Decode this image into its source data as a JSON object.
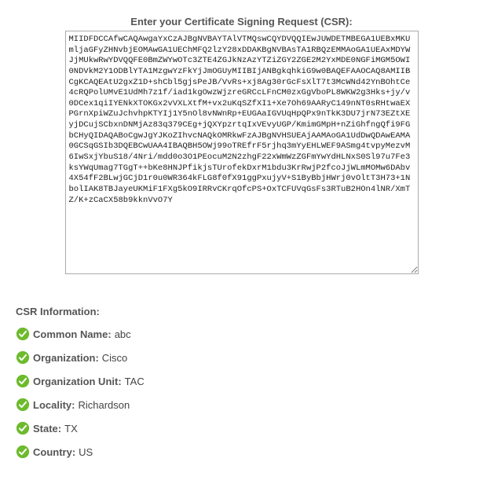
{
  "title": "Enter your Certificate Signing Request (CSR):",
  "csr_text": "MIIDFDCCAfwCAQAwgaYxCzAJBgNVBAYTAlVTMQswCQYDVQQIEwJUWDETMBEGA1UEBxMKUmljaGFyZHNvbjEOMAwGA1UEChMFQ2lzY28xDDAKBgNVBAsTA1RBQzEMMAoGA1UEAxMDYWJjMUkwRwYDVQQFE0BmZWYwOTc3ZTE4ZGJkNzAzYTZiZGY2ZGE2M2YxMDE0NGFiMGM5OWI0NDVkM2Y1ODBlYTA1MzgwYzFkYjJmOGUyMIIBIjANBgkqhkiG9w0BAQEFAAOCAQ8AMIIBCgKCAQEAtU2gxZ1D+shCbl5gjsPeJB/VvRs+xj8Ag30rGcFsXlT7t3McWNd42YnBOhtCe4cRQPolUMvE1UdMh7z1f/iad1kgOwzWjzreGRCcLFnCM0zxGgVboPL8WKW2g3Hks+jy/v0DCex1qiIYENkXTOKGx2vVXLXtfM+vx2uKqSZfXI1+Xe7Oh69AARyC149nNT0sRHtwaEXPGrnXpiWZuJchvhpKTYIj1Y5nOl8vNWnRp+EUGAaIGVUqHpQPx9nTkK3DU7jrN73EZtXEyjDCujSCbxnDNMjAz83q379CEg+jQXYpzrtqIxVEvyUGP/KmimGMpH+nZiGhfngQfi9FGbCHyQIDAQABoCgwJgYJKoZIhvcNAQkOMRkwFzAJBgNVHSUEAjAAMAoGA1UdDwQDAwEAMA0GCSqGSIb3DQEBCwUAA4IBAQBH5OWj99oTREfrF5rjhq3mYyEHLWEF9ASmg4tvpyMezvM6IwSxjYbuS18/4Nri/mdd0o3O1PEocuM2N2zhgF22xWmWzZGFmYwYdHLNxS0Sl97u7Fe3ksYWqUmag7TGgT++bKe8HNJPfikjsTUrofekDxrM1bdu3KrRwjP2fcoJjWLmMOMw6DAbv4X54fF2BLwjGCjD1r0u0WR364kFLG8f0fX91ggPxujyV+S1ByBbjHWrj0vOltT3H73+1NbolIAK8TBJayeUKMiF1FXg5kO9IRRvCKrqOfcPS+OxTCFUVqGsFs3RTuB2HOn4lNR/XmTZ/K+zCaCX58b9kknVvO7Y",
  "info_heading": "CSR Information:",
  "fields": {
    "common_name": {
      "label": "Common Name:",
      "value": "abc"
    },
    "organization": {
      "label": "Organization:",
      "value": "Cisco"
    },
    "organization_unit": {
      "label": "Organization Unit:",
      "value": "TAC"
    },
    "locality": {
      "label": "Locality:",
      "value": "Richardson"
    },
    "state": {
      "label": "State:",
      "value": "TX"
    },
    "country": {
      "label": "Country:",
      "value": "US"
    }
  }
}
